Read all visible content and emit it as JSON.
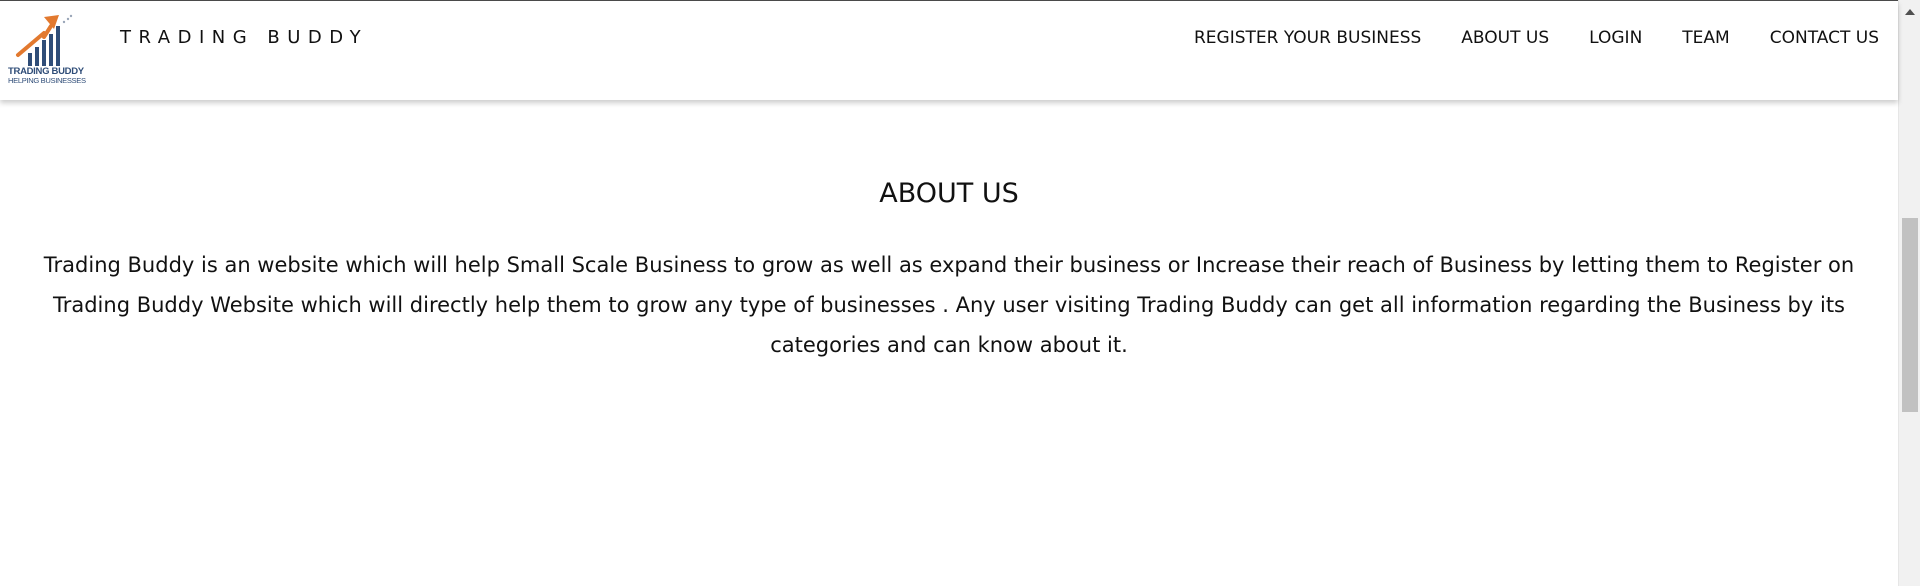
{
  "logo": {
    "line1": "TRADING BUDDY",
    "line2": "HELPING BUSINESSES",
    "colors": {
      "arrow": "#e2792f",
      "bars": "#2f4d78"
    }
  },
  "brand": {
    "title": "TRADING BUDDY"
  },
  "nav": {
    "items": [
      {
        "label": "REGISTER YOUR BUSINESS"
      },
      {
        "label": "ABOUT US"
      },
      {
        "label": "LOGIN"
      },
      {
        "label": "TEAM"
      },
      {
        "label": "CONTACT US"
      }
    ]
  },
  "about": {
    "heading": "ABOUT US",
    "body": "Trading Buddy is an website which will help Small Scale Business to grow as well as expand their business or Increase their reach of Business by letting them to Register on Trading Buddy Website which will directly help them to grow any type of businesses . Any user visiting Trading Buddy can get all information regarding the Business by its categories and can know about it."
  },
  "scrollbar": {
    "position": 0.41
  }
}
